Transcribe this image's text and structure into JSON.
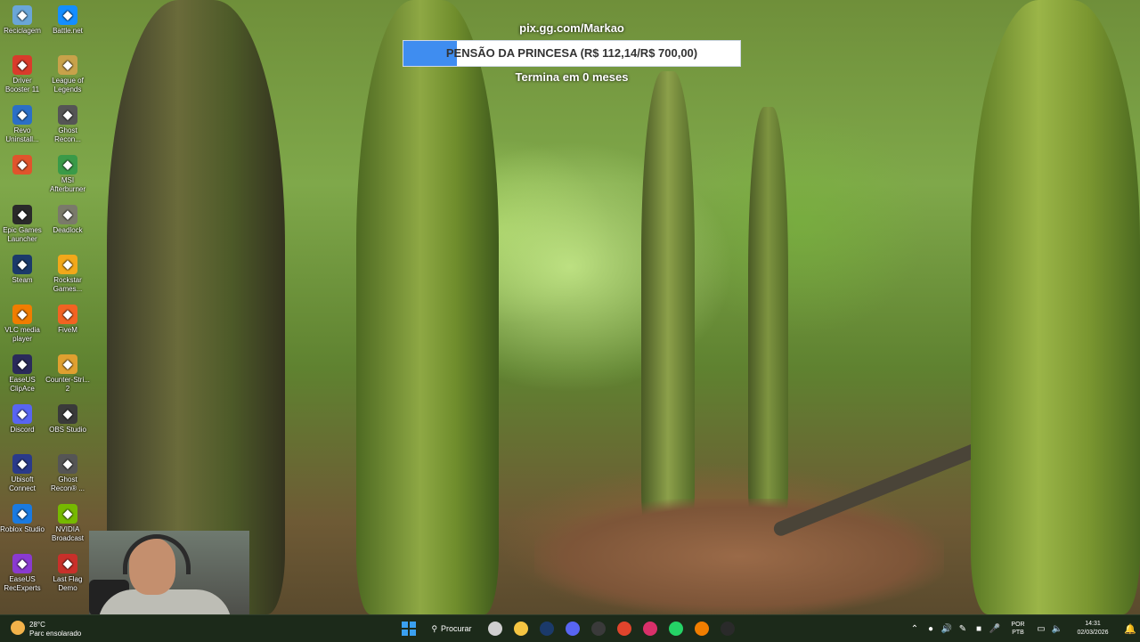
{
  "overlay": {
    "url": "pix.gg.com/Markao",
    "goal_label": "PENSÃO DA PRINCESA (R$ 112,14/R$ 700,00)",
    "goal_progress": 0.16,
    "subtitle": "Termina em 0 meses",
    "bar_color": "#3f8df0"
  },
  "desktop": {
    "icons": [
      {
        "label": "Reciclagem",
        "icon": "recycle-bin-icon",
        "color": "#6aa6d8"
      },
      {
        "label": "Battle.net",
        "icon": "battlenet-icon",
        "color": "#148eff"
      },
      {
        "label": "Driver Booster 11",
        "icon": "driver-booster-icon",
        "color": "#d93b2b"
      },
      {
        "label": "League of Legends",
        "icon": "league-of-legends-icon",
        "color": "#c8a24a"
      },
      {
        "label": "Revo Uninstall...",
        "icon": "revo-uninstaller-icon",
        "color": "#2b6fc6"
      },
      {
        "label": "Ghost Recon...",
        "icon": "ghost-recon-icon",
        "color": "#555555"
      },
      {
        "label": "",
        "icon": "app-icon",
        "color": "#e0542c"
      },
      {
        "label": "MSI Afterburner",
        "icon": "afterburner-icon",
        "color": "#3a9a48"
      },
      {
        "label": "Epic Games Launcher",
        "icon": "epic-games-icon",
        "color": "#2a2a2a"
      },
      {
        "label": "Deadlock",
        "icon": "deadlock-icon",
        "color": "#7a7a6a"
      },
      {
        "label": "Steam",
        "icon": "steam-icon",
        "color": "#1b3a6a"
      },
      {
        "label": "Rockstar Games...",
        "icon": "rockstar-icon",
        "color": "#f2a81a"
      },
      {
        "label": "VLC media player",
        "icon": "vlc-icon",
        "color": "#f07d00"
      },
      {
        "label": "FiveM",
        "icon": "fivem-icon",
        "color": "#f26322"
      },
      {
        "label": "EaseUS ClipAce",
        "icon": "easeus-clipace-icon",
        "color": "#2a2a5a"
      },
      {
        "label": "Counter-Stri... 2",
        "icon": "counter-strike-icon",
        "color": "#e0a030"
      },
      {
        "label": "Discord",
        "icon": "discord-icon",
        "color": "#5865f2"
      },
      {
        "label": "OBS Studio",
        "icon": "obs-icon",
        "color": "#3a3a3a"
      },
      {
        "label": "Ubisoft Connect",
        "icon": "ubisoft-icon",
        "color": "#2a3a8a"
      },
      {
        "label": "Ghost Recon® ...",
        "icon": "ghost-recon-icon",
        "color": "#555555"
      },
      {
        "label": "Roblox Studio",
        "icon": "roblox-studio-icon",
        "color": "#1a7ae0"
      },
      {
        "label": "NVIDIA Broadcast",
        "icon": "nvidia-icon",
        "color": "#76b900"
      },
      {
        "label": "EaseUS RecExperts",
        "icon": "easeus-recexperts-icon",
        "color": "#8a3ad0"
      },
      {
        "label": "Last Flag Demo",
        "icon": "last-flag-icon",
        "color": "#c8302a"
      }
    ]
  },
  "taskbar": {
    "weather_temp": "28°C",
    "weather_desc": "Parc ensolarado",
    "search_label": "Procurar",
    "apps": [
      {
        "icon": "windows-start-icon",
        "color": "#3aa0f0"
      },
      {
        "icon": "search-icon"
      },
      {
        "icon": "task-view-icon",
        "color": "#cfcfcf"
      },
      {
        "icon": "file-explorer-icon",
        "color": "#f5c542"
      },
      {
        "icon": "steam-icon",
        "color": "#1b3a6a"
      },
      {
        "icon": "discord-icon",
        "color": "#5865f2"
      },
      {
        "icon": "obs-icon",
        "color": "#3a3a3a"
      },
      {
        "icon": "chrome-icon",
        "color": "#e0442c"
      },
      {
        "icon": "instagram-icon",
        "color": "#d9306a"
      },
      {
        "icon": "whatsapp-icon",
        "color": "#25d366"
      },
      {
        "icon": "cloud-app-icon",
        "color": "#f07d00"
      },
      {
        "icon": "terminal-icon",
        "color": "#2a2a2a"
      }
    ],
    "lang_1": "POR",
    "lang_2": "PTB",
    "time": "14:31",
    "date": "02/03/2026"
  }
}
